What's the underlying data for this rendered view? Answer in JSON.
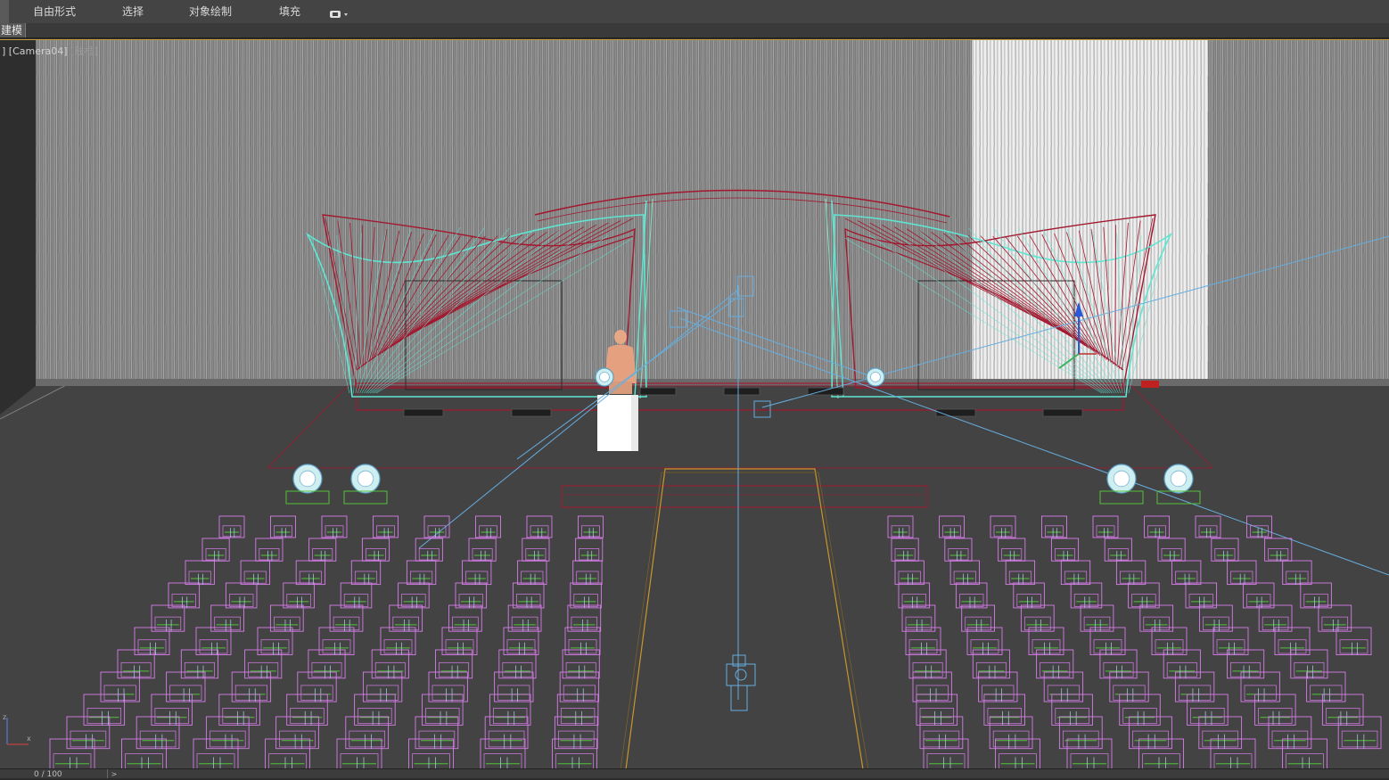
{
  "ribbon": {
    "tabs": [
      {
        "label": "自由形式"
      },
      {
        "label": "选择"
      },
      {
        "label": "对象绘制"
      },
      {
        "label": "填充"
      }
    ],
    "more_icon": "toggle-ribbon-icon",
    "panel_label": "建模"
  },
  "viewport": {
    "label_bracket": "]",
    "camera": "[Camera04]",
    "shading": "[线框]"
  },
  "status": {
    "frame_counter": "0 / 100",
    "next_arrow": ">"
  },
  "colors": {
    "backdrop": "#8a8a8a",
    "arch_red": "#a3182f",
    "arch_cyan": "#5fe6d2",
    "chairs": "#d67de8",
    "chair_legs": "#52c23a",
    "cameras": "#66aee0",
    "runway": "#c8962a"
  }
}
